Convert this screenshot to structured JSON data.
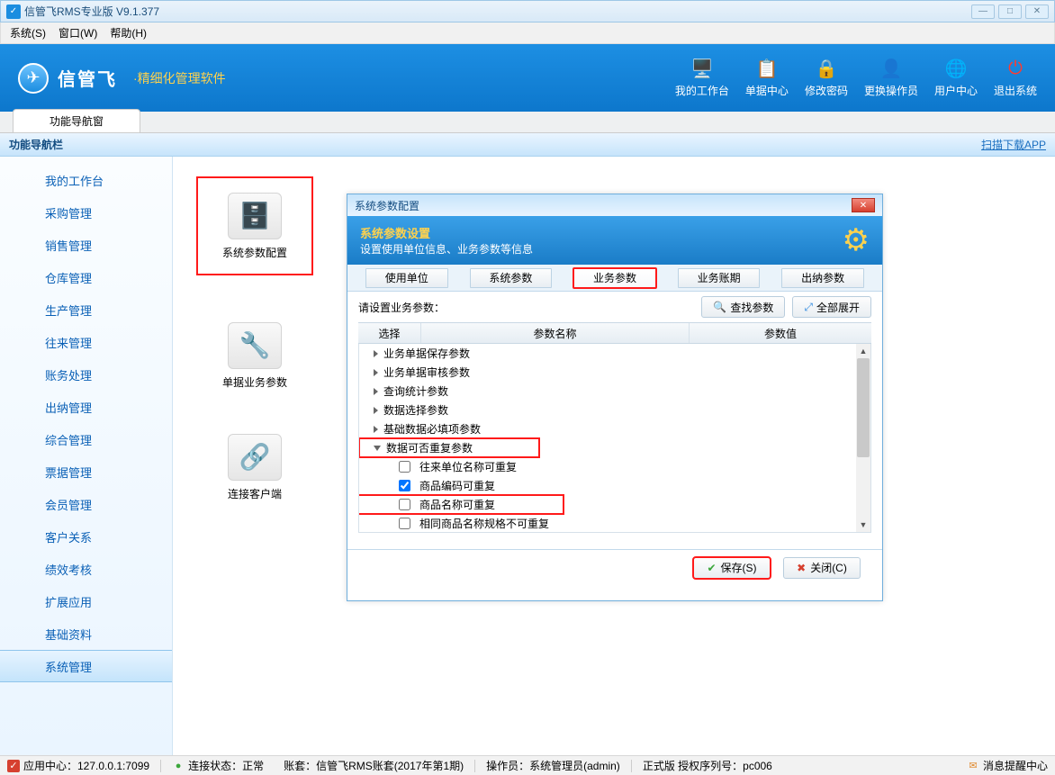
{
  "window": {
    "title": "信管飞RMS专业版 V9.1.377"
  },
  "menubar": [
    "系统(S)",
    "窗口(W)",
    "帮助(H)"
  ],
  "banner": {
    "logo_text": "信管飞",
    "logo_sub": "·精细化管理软件",
    "items": [
      {
        "label": "我的工作台",
        "icon": "🖥️"
      },
      {
        "label": "单据中心",
        "icon": "📋"
      },
      {
        "label": "修改密码",
        "icon": "🔒"
      },
      {
        "label": "更换操作员",
        "icon": "👤"
      },
      {
        "label": "用户中心",
        "icon": "🌐"
      },
      {
        "label": "退出系统",
        "icon": "⏻"
      }
    ]
  },
  "tabrow": {
    "tab0": "功能导航窗"
  },
  "nav_header": {
    "title": "功能导航栏",
    "link": "扫描下载APP"
  },
  "sidebar": {
    "items": [
      "我的工作台",
      "采购管理",
      "销售管理",
      "仓库管理",
      "生产管理",
      "往来管理",
      "账务处理",
      "出纳管理",
      "综合管理",
      "票据管理",
      "会员管理",
      "客户关系",
      "绩效考核",
      "扩展应用",
      "基础资料",
      "系统管理"
    ]
  },
  "big_buttons": {
    "b0": {
      "label": "系统参数配置"
    },
    "b1": {
      "label": "单据业务参数"
    },
    "b2": {
      "label": "连接客户端"
    }
  },
  "dialog": {
    "title": "系统参数配置",
    "banner_title": "系统参数设置",
    "banner_sub": "设置使用单位信息、业务参数等信息",
    "tabs": [
      "使用单位",
      "系统参数",
      "业务参数",
      "业务账期",
      "出纳参数"
    ],
    "toolbar": {
      "label": "请设置业务参数：",
      "search": "查找参数",
      "expand": "全部展开"
    },
    "grid": {
      "cols": [
        "选择",
        "参数名称",
        "参数值"
      ],
      "groups": [
        "业务单据保存参数",
        "业务单据审核参数",
        "查询统计参数",
        "数据选择参数",
        "基础数据必填项参数",
        "数据可否重复参数"
      ],
      "children": [
        {
          "label": "往来单位名称可重复",
          "checked": false
        },
        {
          "label": "商品编码可重复",
          "checked": true
        },
        {
          "label": "商品名称可重复",
          "checked": false
        },
        {
          "label": "相同商品名称规格不可重复",
          "checked": false
        }
      ]
    },
    "footer": {
      "save": "保存(S)",
      "close": "关闭(C)"
    }
  },
  "status": {
    "app_center": "应用中心：127.0.0.1:7099",
    "conn": "连接状态：正常",
    "account": "账套：信管飞RMS账套(2017年第1期)",
    "operator": "操作员：系统管理员(admin)",
    "license": "正式版 授权序列号：pc006",
    "notify": "消息提醒中心"
  }
}
